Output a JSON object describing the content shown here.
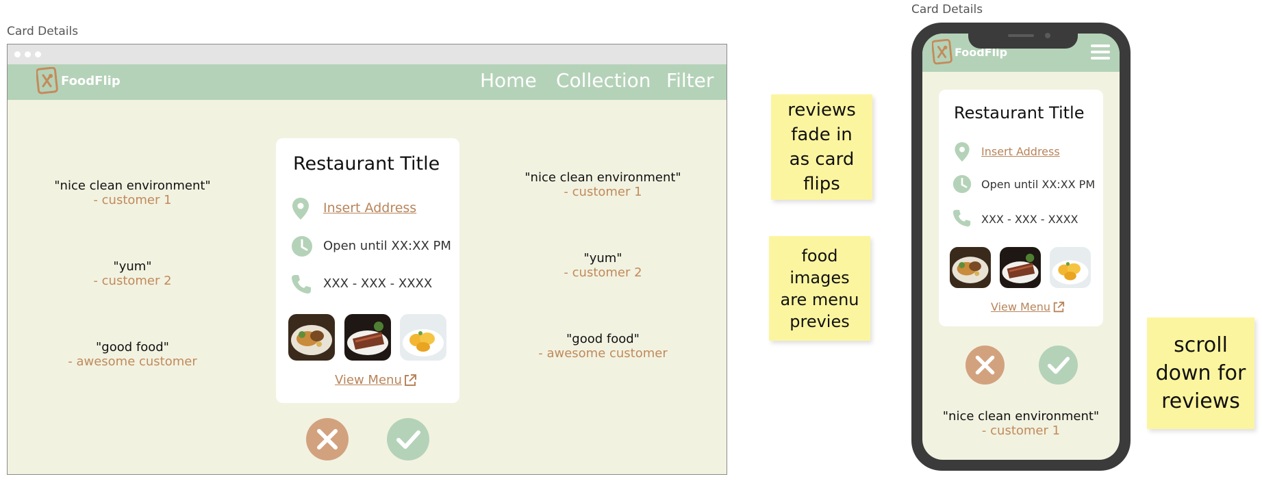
{
  "desktop": {
    "frame_label": "Card Details",
    "logo": "FoodFlip",
    "nav": [
      "Home",
      "Collection",
      "Filter"
    ],
    "card": {
      "title": "Restaurant Title",
      "address": "Insert Address",
      "hours": "Open until XX:XX PM",
      "phone": "XXX - XXX - XXXX",
      "view_menu": "View Menu"
    },
    "reviews_left": [
      {
        "quote": "\"nice clean environment\"",
        "author": "- customer 1"
      },
      {
        "quote": "\"yum\"",
        "author": "- customer 2"
      },
      {
        "quote": "\"good food\"",
        "author": "- awesome customer"
      }
    ],
    "reviews_right": [
      {
        "quote": "\"nice clean environment\"",
        "author": "- customer 1"
      },
      {
        "quote": "\"yum\"",
        "author": "- customer 2"
      },
      {
        "quote": "\"good food\"",
        "author": "- awesome customer"
      }
    ]
  },
  "notes": {
    "fade": "reviews fade in as card flips",
    "images": "food images are menu previes",
    "scroll": "scroll down for reviews"
  },
  "mobile": {
    "frame_label": "Card Details",
    "logo": "FoodFlip",
    "card": {
      "title": "Restaurant Title",
      "address": "Insert Address",
      "hours": "Open until XX:XX PM",
      "phone": "XXX - XXX - XXXX",
      "view_menu": "View Menu"
    },
    "review": {
      "quote": "\"nice clean environment\"",
      "author": "- customer 1"
    }
  },
  "colors": {
    "accent_green": "#b4d2b8",
    "accent_tan": "#d2a27e",
    "background": "#f2f2e1",
    "sticky": "#fcf59f",
    "link": "#b8845a"
  },
  "icons": [
    "logo-icon",
    "location-pin-icon",
    "clock-icon",
    "phone-icon",
    "external-link-icon",
    "close-icon",
    "check-icon",
    "hamburger-menu-icon"
  ]
}
